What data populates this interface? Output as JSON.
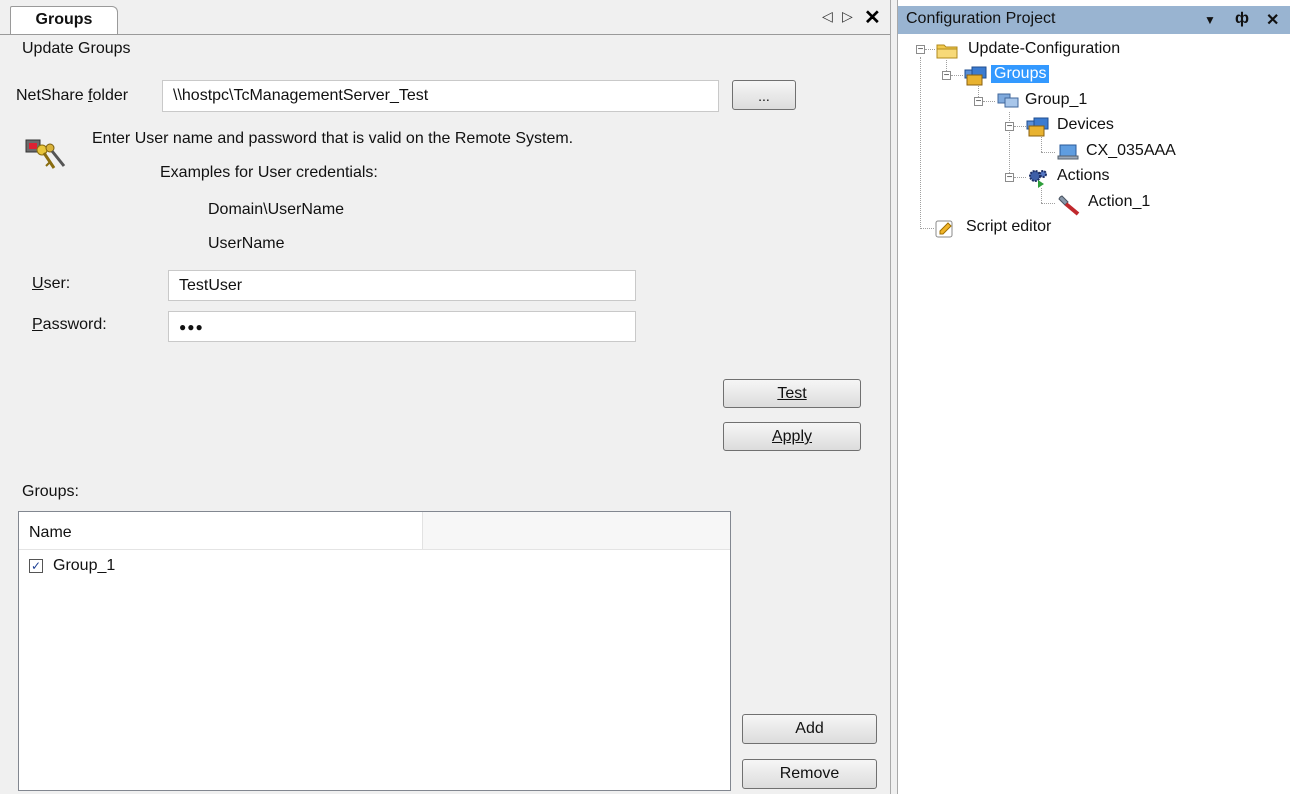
{
  "document": {
    "tab_title": "Groups",
    "section_title": "Update Groups",
    "netshare": {
      "label": "NetShare folder",
      "value": "\\\\hostpc\\TcManagementServer_Test",
      "browse_label": "..."
    },
    "info": {
      "message": "Enter User name and password that is valid on the Remote System.",
      "examples_title": "Examples for User credentials:",
      "example_1": "Domain\\UserName",
      "example_2": "UserName"
    },
    "user": {
      "label": "User:",
      "value": "TestUser"
    },
    "password": {
      "label": "Password:",
      "value": "●●●"
    },
    "test_label": "Test",
    "apply_label": "Apply",
    "groups_label": "Groups:",
    "groups_table": {
      "columns": [
        "Name",
        ""
      ],
      "rows": [
        {
          "name": "Group_1",
          "checked": true
        }
      ]
    },
    "add_label": "Add",
    "remove_label": "Remove"
  },
  "tool_window": {
    "title": "Configuration Project",
    "tree": {
      "root": "Update-Configuration",
      "groups": "Groups",
      "group_1": "Group_1",
      "devices": "Devices",
      "device_1": "CX_035AAA",
      "actions": "Actions",
      "action_1": "Action_1",
      "script_editor": "Script editor"
    }
  },
  "colors": {
    "selection": "#3399ff",
    "title_bar": "#99b4d1",
    "background": "#f0f0f0"
  }
}
